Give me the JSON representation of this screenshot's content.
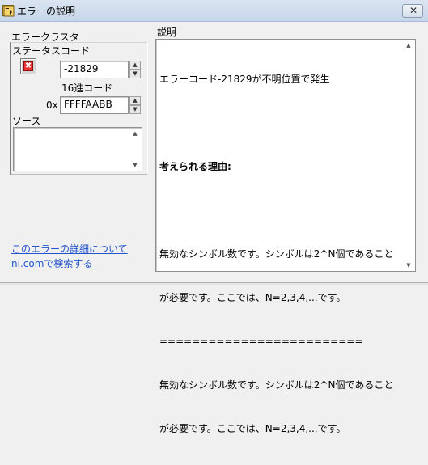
{
  "window": {
    "title": "エラーの説明",
    "close_label": "✕"
  },
  "error_cluster": {
    "title": "エラークラスタ",
    "status_label": "ステータスコード",
    "status_symbol": "✖",
    "code_value": "-21829",
    "hex_label": "16進コード",
    "hex_prefix": "0x",
    "hex_value": "FFFFAABB",
    "source_label": "ソース",
    "source_value": ""
  },
  "description": {
    "title": "説明",
    "line1": "エラーコード-21829が不明位置で発生",
    "reason_heading": "考えられる理由:",
    "para1_line1": "無効なシンボル数です。シンボルは2^N個であること",
    "para1_line2": "が必要です。ここでは、N=2,3,4,...です。",
    "separator": "=========================",
    "para2_line1": "無効なシンボル数です。シンボルは2^N個であること",
    "para2_line2": "が必要です。ここでは、N=2,3,4,...です。"
  },
  "links": {
    "detail_line1": "このエラーの詳細について",
    "detail_line2": "ni.comで検索する"
  },
  "icons": {
    "app": "labview-app-icon",
    "close": "close-icon",
    "status": "error-x-icon"
  }
}
